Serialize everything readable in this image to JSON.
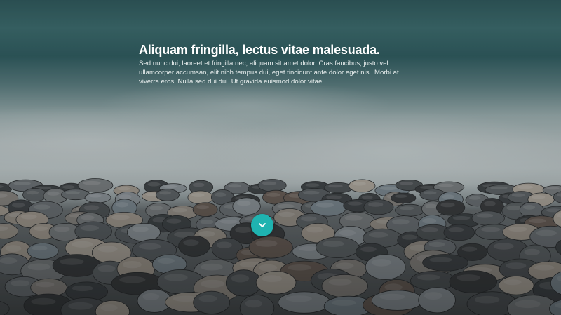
{
  "hero": {
    "headline": "Aliquam fringilla, lectus vitae malesuada.",
    "body": "Sed nunc dui, laoreet et fringilla nec, aliquam sit amet dolor. Cras faucibus, justo vel ullamcorper accumsan, elit nibh tempus dui, eget tincidunt ante dolor eget nisi. Morbi at viverra eros. Nulla sed dui dui. Ut gravida euismod dolor vitae.",
    "background_image": "pebble-beach-with-sea-waves",
    "scroll_button": {
      "icon": "chevron-down-icon",
      "color": "#1fb3b0"
    }
  }
}
